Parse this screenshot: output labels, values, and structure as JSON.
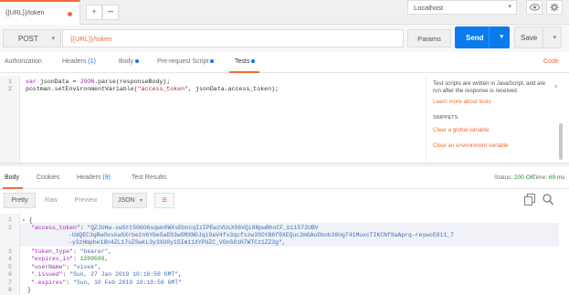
{
  "tabs": {
    "active_label": "{{URL}}/token",
    "add_label": "+",
    "more_label": "•••"
  },
  "environment": {
    "selected": "Localhost"
  },
  "request": {
    "method": "POST",
    "url": "{{URL}}/token",
    "params_label": "Params",
    "send_label": "Send",
    "save_label": "Save"
  },
  "request_tabs": [
    {
      "label": "Authorization"
    },
    {
      "label": "Headers",
      "count": "(1)"
    },
    {
      "label": "Body"
    },
    {
      "label": "Pre-request Script"
    },
    {
      "label": "Tests"
    }
  ],
  "code_link": "Code",
  "tests_editor": {
    "lines": [
      {
        "num": "1",
        "parts": [
          {
            "t": "var ",
            "c": "kw"
          },
          {
            "t": "jsonData = ",
            "c": ""
          },
          {
            "t": "JSON",
            "c": "kw"
          },
          {
            "t": ".parse(responseBody);",
            "c": ""
          }
        ]
      },
      {
        "num": "2",
        "parts": [
          {
            "t": "postman.setEnvironmentVariable(",
            "c": ""
          },
          {
            "t": "\"access_token\"",
            "c": "str"
          },
          {
            "t": ", jsonData.access_token);",
            "c": ""
          }
        ]
      }
    ]
  },
  "snippets_panel": {
    "description": "Test scripts are written in JavaScript, and are run after the response is received.",
    "learn_more": "Learn more about tests",
    "heading": "SNIPPETS",
    "items": [
      "Clear a global variable",
      "Clear an environment variable"
    ]
  },
  "response_tabs": [
    {
      "label": "Body"
    },
    {
      "label": "Cookies"
    },
    {
      "label": "Headers",
      "count": "(9)"
    },
    {
      "label": "Test Results"
    }
  ],
  "response_status": {
    "status_label": "Status:",
    "status_value": "200 OK",
    "time_label": "Time:",
    "time_value": "69 ms"
  },
  "response_toolbar": {
    "pretty": "Pretty",
    "raw": "Raw",
    "preview": "Preview",
    "format": "JSON"
  },
  "response_body": {
    "line_numbers": [
      "1",
      "2",
      "",
      "",
      "3",
      "4",
      "5",
      "6",
      "7",
      "8"
    ],
    "open_brace": "{",
    "close_brace": "}",
    "access_token_key": "\"access_token\"",
    "access_token_line1": "\"QZJUHw-swStt5G6O6sqwn0WXsEbncqIzIPEwzVUsXS6VQi8NpwBhoCF_bi1572UBV",
    "access_token_line2": "-UdQEC3gRwOvskwSXrbetn6YGeSaDS3wSMXN0Jqi9aV4fv3qcfszw3SOtB6f8XEQuc2mGAoDbnb36UgT41MuxcTIKCNf8aAprq-reywcE811_7",
    "access_token_line3": "-y3zHmphe18n4ZL17oZSwkL3y3XU0y1SIm11XYPUZC_VOnS81H7WTCz1ZZ3g\",",
    "token_type_key": "\"token_type\"",
    "token_type_val": "\"bearer\"",
    "expires_in_key": "\"expires_in\"",
    "expires_in_val": "1209599",
    "username_key": "\"userName\"",
    "username_val": "\"vivek\"",
    "issued_key": "\".issued\"",
    "issued_val": "\"Sun, 27 Jan 2019 10:10:58 GMT\"",
    "expires_key": "\".expires\"",
    "expires_val": "\"Sun, 10 Feb 2019 10:10:58 GMT\""
  }
}
